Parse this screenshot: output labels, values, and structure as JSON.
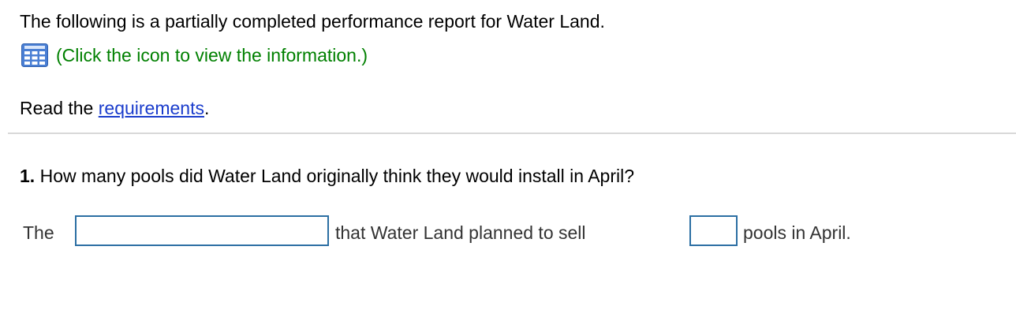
{
  "intro": {
    "text": "The following is a partially completed performance report for Water Land."
  },
  "info": {
    "icon": "grid-table-icon",
    "link_text": "(Click the icon to view the information.)",
    "link_color": "#008000"
  },
  "requirements": {
    "prefix": "Read the ",
    "link_text": "requirements",
    "suffix": ".",
    "link_color": "#1a3ccc"
  },
  "question": {
    "number": "1.",
    "text": " How many pools did Water Land originally think they would install in April?"
  },
  "answer": {
    "prefix": "The",
    "input1_value": "",
    "middle": "that Water Land planned to sell",
    "input2_value": "",
    "suffix": "pools in April.",
    "input_border_color": "#2c6fa3"
  }
}
